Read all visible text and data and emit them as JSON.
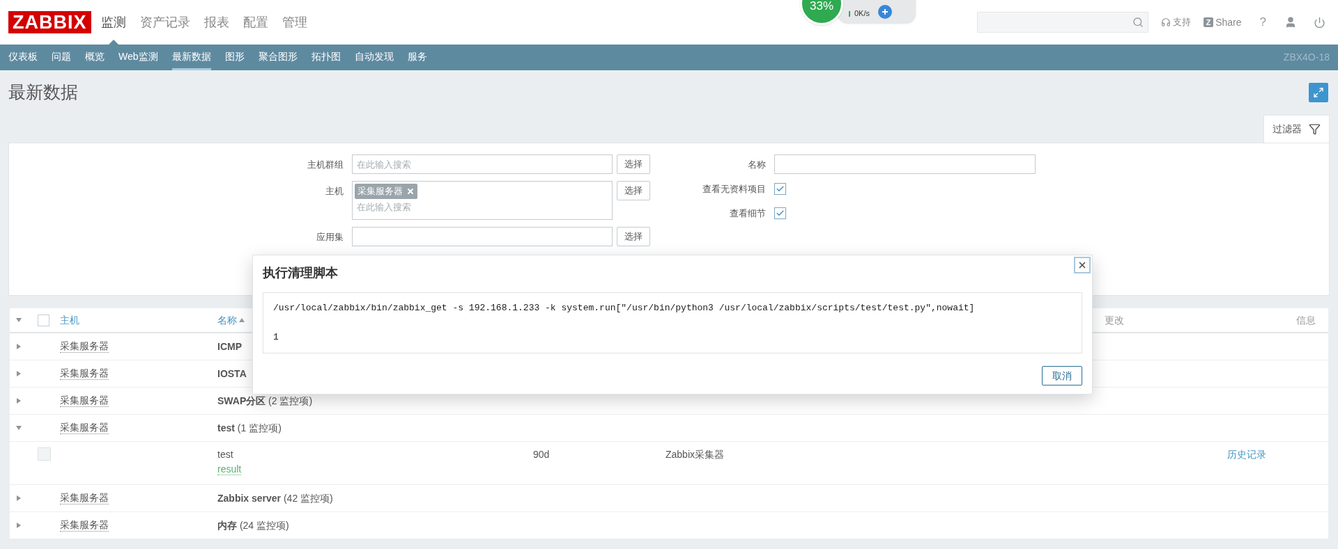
{
  "header": {
    "logo": "ZABBIX",
    "menu": [
      {
        "label": "监测",
        "selected": true
      },
      {
        "label": "资产记录",
        "selected": false
      },
      {
        "label": "报表",
        "selected": false
      },
      {
        "label": "配置",
        "selected": false
      },
      {
        "label": "管理",
        "selected": false
      }
    ],
    "support": "支持",
    "share_badge": "Z",
    "share": "Share",
    "help": "?"
  },
  "speed_widget": {
    "percent": "33%",
    "rate": "0K/s"
  },
  "subnav": {
    "items": [
      {
        "label": "仪表板",
        "selected": false
      },
      {
        "label": "问题",
        "selected": false
      },
      {
        "label": "概览",
        "selected": false
      },
      {
        "label": "Web监测",
        "selected": false
      },
      {
        "label": "最新数据",
        "selected": true
      },
      {
        "label": "图形",
        "selected": false
      },
      {
        "label": "聚合图形",
        "selected": false
      },
      {
        "label": "拓扑图",
        "selected": false
      },
      {
        "label": "自动发现",
        "selected": false
      },
      {
        "label": "服务",
        "selected": false
      }
    ],
    "server_name": "ZBX4O-18"
  },
  "page": {
    "title": "最新数据"
  },
  "filter": {
    "tab_label": "过滤器",
    "left": [
      {
        "kind": "search",
        "label": "主机群组",
        "placeholder": "在此输入搜索",
        "button": "选择"
      },
      {
        "kind": "multiselect",
        "label": "主机",
        "chips": [
          "采集服务器"
        ],
        "placeholder": "在此输入搜索",
        "button": "选择"
      },
      {
        "kind": "text",
        "label": "应用集",
        "button": "选择"
      }
    ],
    "right": [
      {
        "kind": "text",
        "label": "名称"
      },
      {
        "kind": "checkbox",
        "label": "查看无资料项目",
        "checked": true
      },
      {
        "kind": "checkbox",
        "label": "查看细节",
        "checked": true
      }
    ]
  },
  "table": {
    "select_all": {
      "checked": false
    },
    "columns": [
      {
        "kind": "host",
        "label": "主机",
        "sorted": false
      },
      {
        "kind": "name",
        "label": "名称",
        "sorted": true
      },
      {
        "kind": "change",
        "label": "更改",
        "sorted": false
      },
      {
        "kind": "info",
        "label": "信息",
        "sorted": false
      }
    ],
    "groups": [
      {
        "host": "采集服务器",
        "name": "ICMP",
        "expanded": false
      },
      {
        "host": "采集服务器",
        "name": "IOSTA",
        "expanded": false
      },
      {
        "host": "采集服务器",
        "name": "SWAP分区",
        "count": "(2 监控项)",
        "expanded": false
      },
      {
        "host": "采集服务器",
        "name": "test",
        "count": "(1 监控项)",
        "expanded": true,
        "items": [
          {
            "name": "test",
            "key": "result",
            "interval": "90d",
            "type": "Zabbix采集器",
            "history": "历史记录",
            "checked": false
          }
        ]
      },
      {
        "host": "采集服务器",
        "name": "Zabbix server",
        "count": "(42 监控项)",
        "expanded": false
      },
      {
        "host": "采集服务器",
        "name": "内存",
        "count": "(24 监控项)",
        "expanded": false
      }
    ]
  },
  "modal": {
    "title": "执行清理脚本",
    "command": "/usr/local/zabbix/bin/zabbix_get -s 192.168.1.233 -k system.run[\"/usr/bin/python3 /usr/local/zabbix/scripts/test/test.py\",nowait]",
    "output": "1",
    "cancel": "取消"
  }
}
